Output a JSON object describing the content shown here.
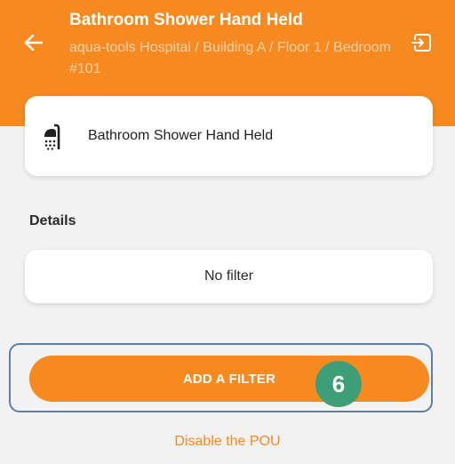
{
  "header": {
    "title": "Bathroom Shower Hand Held",
    "subtitle": "aqua-tools Hospital / Building A / Floor 1 / Bedroom #101",
    "back_icon": "arrow-left-icon",
    "exit_icon": "exit-icon"
  },
  "device": {
    "name": "Bathroom Shower Hand Held",
    "icon": "shower-icon"
  },
  "details": {
    "label": "Details",
    "filter_status": "No filter"
  },
  "actions": {
    "add_filter_label": "ADD A FILTER",
    "disable_label": "Disable the POU"
  },
  "annotation": {
    "step_number": "6"
  },
  "colors": {
    "brand": "#f6891f",
    "badge": "#3e9e77",
    "highlight_border": "#5b7fa8",
    "background": "#f2f2f2"
  }
}
